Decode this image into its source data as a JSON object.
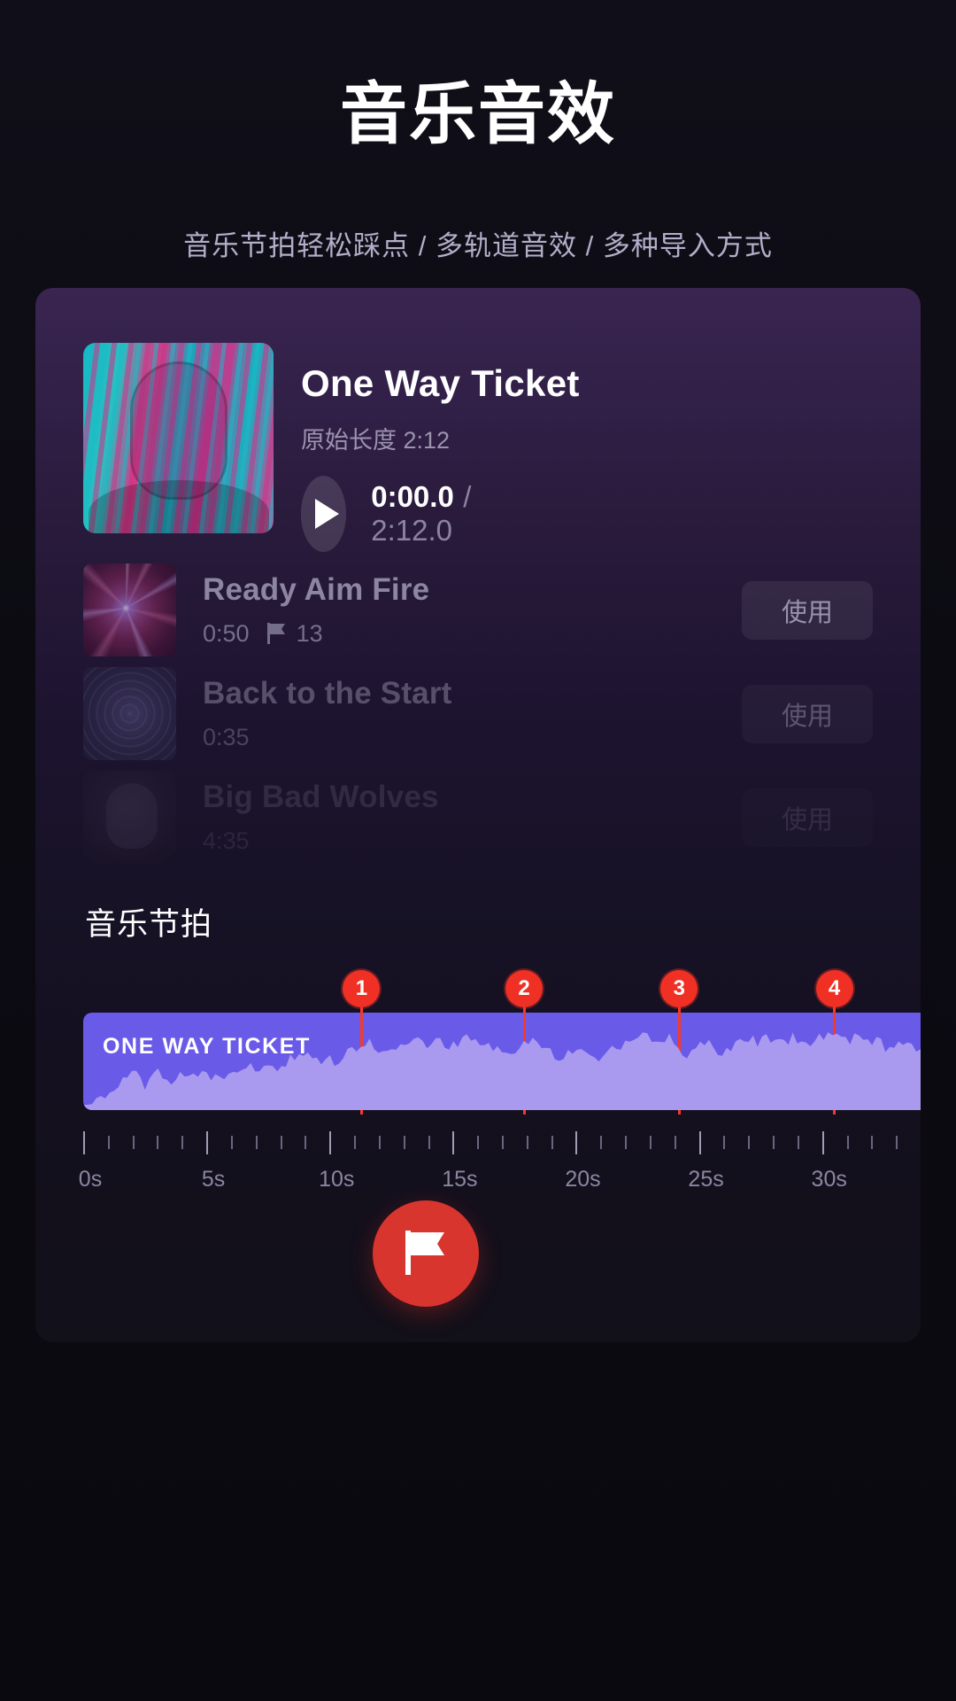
{
  "header": {
    "title": "音乐音效",
    "subtitle": "音乐节拍轻松踩点 / 多轨道音效 / 多种导入方式"
  },
  "now_playing": {
    "title": "One Way Ticket",
    "meta": "原始长度 2:12",
    "play_icon": "play-icon",
    "current_time": "0:00.0",
    "separator": "/",
    "total_time": "2:12.0",
    "cover_icon": "album-cover-portrait"
  },
  "tracks": [
    {
      "name": "Ready Aim Fire",
      "duration": "0:50",
      "beat_icon": "flag-icon",
      "beat_count": "13",
      "use_label": "使用",
      "thumb_icon": "album-thumb-plasma"
    },
    {
      "name": "Back to the Start",
      "duration": "0:35",
      "beat_count": "",
      "use_label": "使用",
      "thumb_icon": "album-thumb-swirl"
    },
    {
      "name": "Big Bad Wolves",
      "duration": "4:35",
      "beat_count": "",
      "use_label": "使用",
      "thumb_icon": "album-thumb-portrait"
    }
  ],
  "beats": {
    "section_title": "音乐节拍",
    "waveform_label": "ONE WAY TICKET",
    "markers": [
      {
        "label": "1",
        "time_s": 11.3
      },
      {
        "label": "2",
        "time_s": 17.9
      },
      {
        "label": "3",
        "time_s": 24.2
      },
      {
        "label": "4",
        "time_s": 30.5
      }
    ],
    "ruler": {
      "labels": [
        "0s",
        "5s",
        "10s",
        "15s",
        "20s",
        "25s",
        "30s"
      ],
      "label_times": [
        0,
        5,
        10,
        15,
        20,
        25,
        30
      ],
      "range_s": [
        0,
        34
      ],
      "minor_step_s": 1
    },
    "fab_icon": "flag-icon"
  },
  "colors": {
    "accent_red": "#e02b22",
    "wave_purple": "#6a5ae8",
    "wave_fill": "#a99af0",
    "page_bg": "#0d0c14",
    "card_top": "#3a2550"
  }
}
